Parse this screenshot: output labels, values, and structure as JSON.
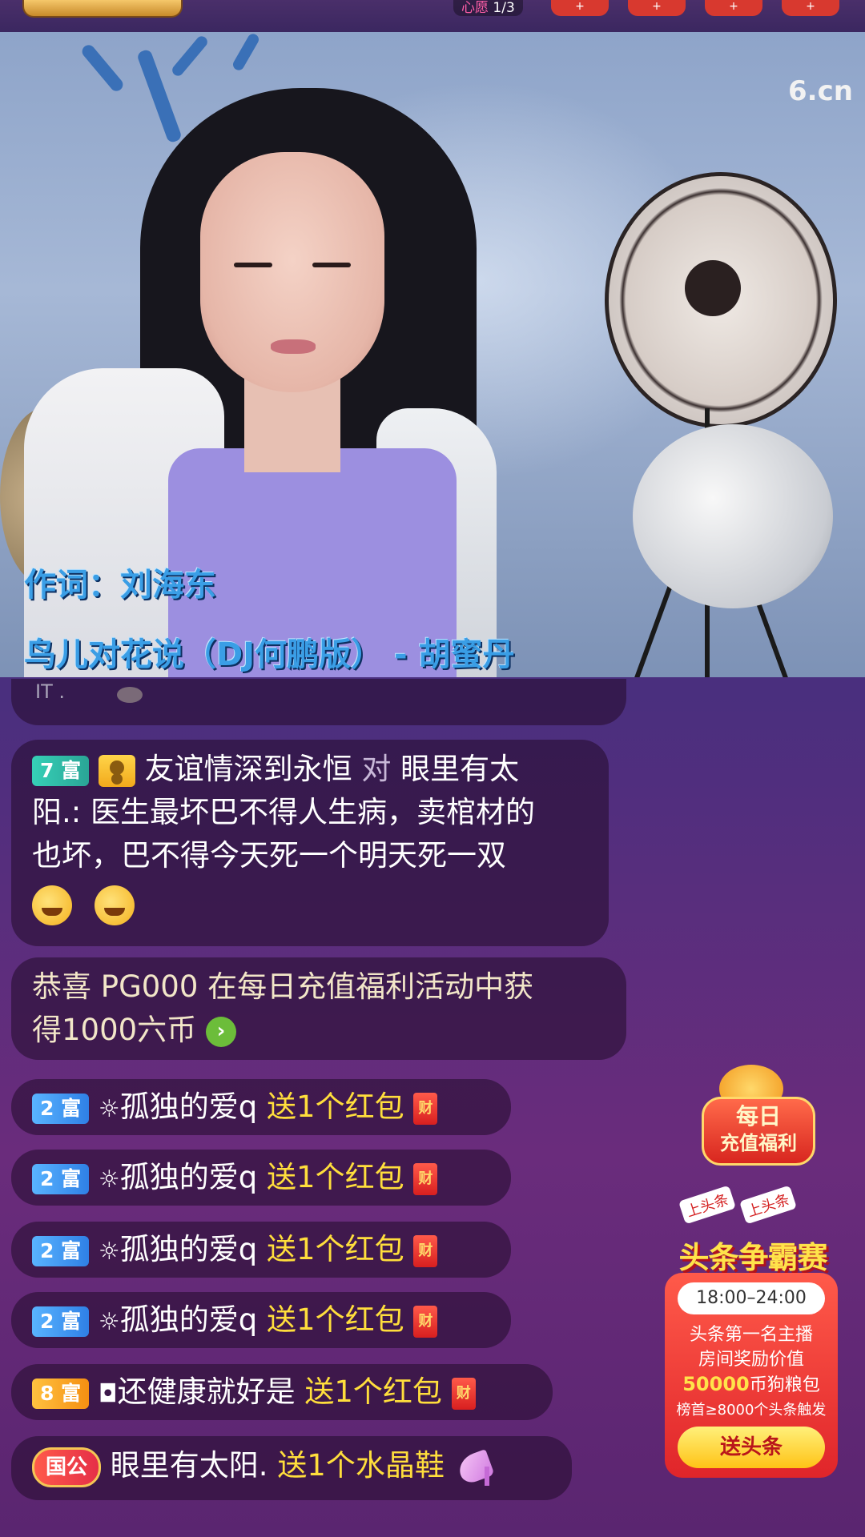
{
  "top_bar": {
    "wish_label": "心愿",
    "wish_count": "1/3",
    "buttons": [
      "+",
      "+",
      "+",
      "+"
    ]
  },
  "video": {
    "watermark": "6.cn",
    "lyric_line1": "作词：刘海东",
    "lyric_line2": "鸟儿对花说（DJ何鹏版） - 胡蜜丹"
  },
  "chat": {
    "prev_stub": "IT .",
    "messages": [
      {
        "level": "7 富",
        "sender": "友谊情深到永恒",
        "to_word": "对",
        "target": "眼里有太阳.",
        "line1_tail": "",
        "text_line2": "阳.: 医生最坏巴不得人生病，卖棺材的",
        "text_line3": "也坏，巴不得今天死一个明天死一双"
      }
    ],
    "system_notice": {
      "line1": "恭喜 PG000  在每日充值福利活动中获",
      "line2": "得1000六币"
    },
    "gifts": [
      {
        "level": "2 富",
        "user": "孤独的爱q",
        "action": "送1个红包",
        "icon": "财"
      },
      {
        "level": "2 富",
        "user": "孤独的爱q",
        "action": "送1个红包",
        "icon": "财"
      },
      {
        "level": "2 富",
        "user": "孤独的爱q",
        "action": "送1个红包",
        "icon": "财"
      },
      {
        "level": "2 富",
        "user": "孤独的爱q",
        "action": "送1个红包",
        "icon": "财"
      },
      {
        "level": "8 富",
        "user": "还健康就好是",
        "action": "送1个红包",
        "icon": "财"
      },
      {
        "badge": "国公",
        "user": "眼里有太阳.",
        "action": "送1个水晶鞋"
      }
    ]
  },
  "promos": {
    "daily": {
      "line1": "每日",
      "line2": "充值福利"
    },
    "headline": {
      "tags": [
        "上头条",
        "上头条"
      ],
      "title": "头条争霸赛",
      "time": "18:00–24:00",
      "desc1": "头条第一名主播",
      "desc2": "房间奖励价值",
      "amount": "50000",
      "desc3": "币狗粮包",
      "desc4": "榜首≥8000个头条触发",
      "button": "送头条"
    }
  }
}
